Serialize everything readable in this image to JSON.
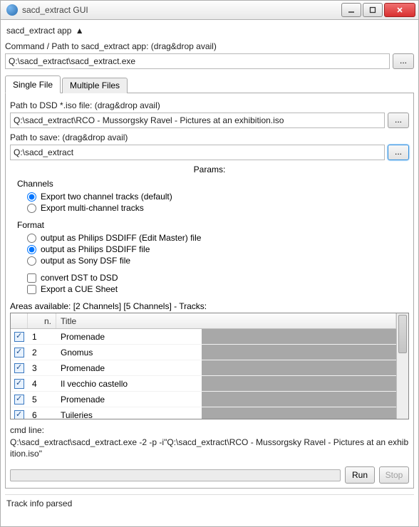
{
  "window": {
    "title": "sacd_extract GUI"
  },
  "section": {
    "header": "sacd_extract app",
    "arrow": "▲"
  },
  "command": {
    "label": "Command / Path to sacd_extract app: (drag&drop avail)",
    "value": "Q:\\sacd_extract\\sacd_extract.exe",
    "browse": "..."
  },
  "tabs": {
    "single": "Single File",
    "multiple": "Multiple Files"
  },
  "iso": {
    "label": "Path to DSD *.iso file: (drag&drop avail)",
    "value": "Q:\\sacd_extract\\RCO - Mussorgsky Ravel - Pictures at an exhibition.iso",
    "browse": "..."
  },
  "save": {
    "label": "Path to save: (drag&drop avail)",
    "value": "Q:\\sacd_extract",
    "browse": "..."
  },
  "params": {
    "header": "Params:",
    "channels": {
      "label": "Channels",
      "opt_two": "Export two channel tracks (default)",
      "opt_multi": "Export multi-channel tracks"
    },
    "format": {
      "label": "Format",
      "opt_edit": "output as Philips DSDIFF (Edit Master) file",
      "opt_dsdiff": "output as Philips DSDIFF file",
      "opt_dsf": "output as Sony DSF file"
    },
    "extras": {
      "dst": "convert DST to DSD",
      "cue": "Export a CUE Sheet"
    }
  },
  "areas": {
    "label": "Areas available: [2 Channels] [5 Channels] - Tracks:",
    "columns": {
      "check": "",
      "n": "n.",
      "title": "Title"
    },
    "rows": [
      {
        "checked": true,
        "n": "1",
        "title": "Promenade"
      },
      {
        "checked": true,
        "n": "2",
        "title": "Gnomus"
      },
      {
        "checked": true,
        "n": "3",
        "title": "Promenade"
      },
      {
        "checked": true,
        "n": "4",
        "title": "Il vecchio castello"
      },
      {
        "checked": true,
        "n": "5",
        "title": "Promenade"
      },
      {
        "checked": true,
        "n": "6",
        "title": "Tuileries"
      }
    ]
  },
  "cmdline": {
    "label": "cmd line:",
    "value": "Q:\\sacd_extract\\sacd_extract.exe -2 -p  -i\"Q:\\sacd_extract\\RCO - Mussorgsky Ravel - Pictures at an exhibition.iso\""
  },
  "buttons": {
    "run": "Run",
    "stop": "Stop"
  },
  "status": "Track info parsed"
}
